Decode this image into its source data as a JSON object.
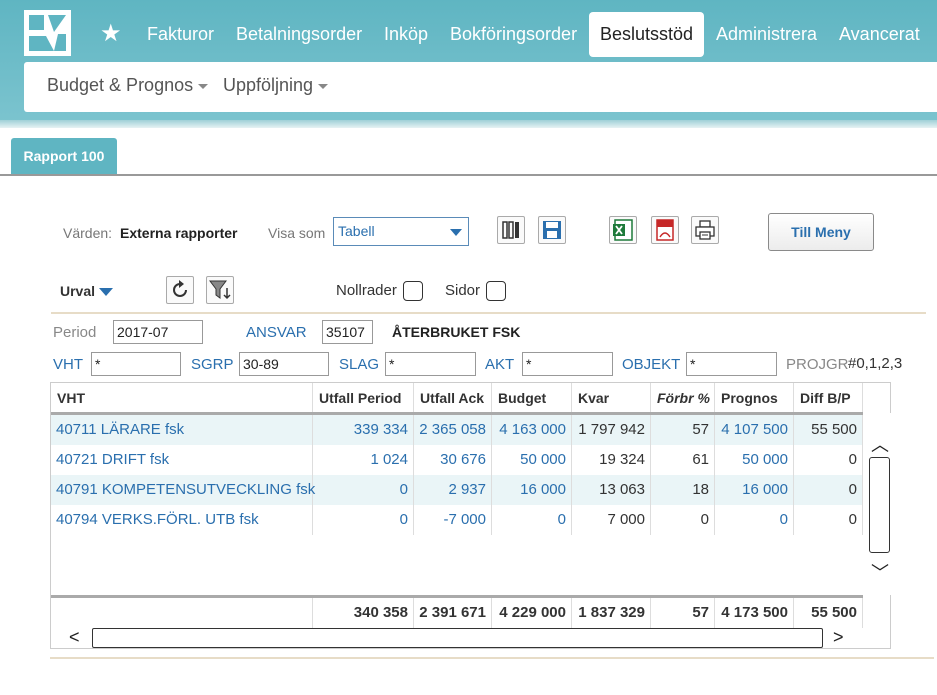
{
  "nav": {
    "items": [
      "Fakturor",
      "Betalningsorder",
      "Inköp",
      "Bokföringsorder",
      "Beslutsstöd",
      "Administrera",
      "Avancerat"
    ],
    "active": "Beslutsstöd"
  },
  "subnav": {
    "items": [
      "Budget & Prognos",
      "Uppföljning"
    ]
  },
  "tab": {
    "label": "Rapport 100"
  },
  "toolbar": {
    "values_label": "Värden:",
    "values_value": "Externa rapporter",
    "show_as_label": "Visa som",
    "show_as_selected": "Tabell",
    "menu_button": "Till Meny"
  },
  "filters": {
    "urval_label": "Urval",
    "nollrader_label": "Nollrader",
    "sidor_label": "Sidor",
    "period_label": "Period",
    "period_value": "2017-07",
    "ansvar_label": "ANSVAR",
    "ansvar_value": "35107",
    "ansvar_name": "ÅTERBRUKET FSK",
    "vht_label": "VHT",
    "vht_value": "*",
    "sgrp_label": "SGRP",
    "sgrp_value": "30-89",
    "slag_label": "SLAG",
    "slag_value": "*",
    "akt_label": "AKT",
    "akt_value": "*",
    "objekt_label": "OBJEKT",
    "objekt_value": "*",
    "projgr_label": "PROJGR",
    "projgr_value": "#0,1,2,3"
  },
  "table": {
    "columns": [
      "VHT",
      "Utfall Period",
      "Utfall Ack",
      "Budget",
      "Kvar",
      "Förbr %",
      "Prognos",
      "Diff B/P"
    ],
    "rows": [
      [
        "40711 LÄRARE fsk",
        "339 334",
        "2 365 058",
        "4 163 000",
        "1 797 942",
        "57",
        "4 107 500",
        "55 500"
      ],
      [
        "40721 DRIFT fsk",
        "1 024",
        "30 676",
        "50 000",
        "19 324",
        "61",
        "50 000",
        "0"
      ],
      [
        "40791 KOMPETENSUTVECKLING fsk",
        "0",
        "2 937",
        "16 000",
        "13 063",
        "18",
        "16 000",
        "0"
      ],
      [
        "40794 VERKS.FÖRL. UTB fsk",
        "0",
        "-7 000",
        "0",
        "7 000",
        "0",
        "0",
        "0"
      ]
    ],
    "totals": [
      "340 358",
      "2 391 671",
      "4 229 000",
      "1 837 329",
      "57",
      "4 173 500",
      "55 500"
    ]
  },
  "colors": {
    "accent": "#5fb5c2",
    "link": "#2a6fae",
    "row_alt": "#eaf5f7"
  }
}
